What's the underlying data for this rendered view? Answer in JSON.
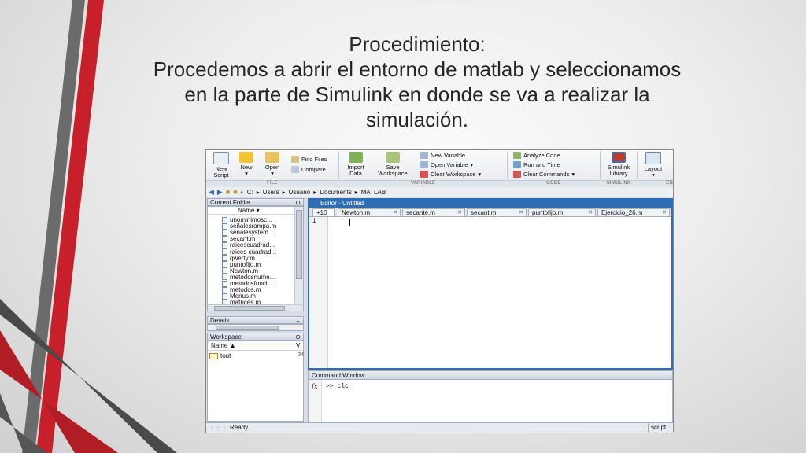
{
  "slide": {
    "title_lines": [
      "Procedimiento:",
      "Procedemos a abrir el entorno de matlab y seleccionamos",
      "en la parte de Simulink en donde se va a realizar la",
      "simulación."
    ]
  },
  "ribbon": {
    "new_script": [
      "New",
      "Script"
    ],
    "new": "New",
    "open": "Open",
    "find_files": "Find Files",
    "compare": "Compare",
    "import_data": [
      "Import",
      "Data"
    ],
    "save_workspace": [
      "Save",
      "Workspace"
    ],
    "new_variable": "New Variable",
    "open_variable": "Open Variable",
    "clear_workspace": "Clear Workspace",
    "analyze_code": "Analyze Code",
    "run_and_time": "Run and Time",
    "clear_commands": "Clear Commands",
    "simulink_library": [
      "Simulink",
      "Library"
    ],
    "layout": "Layout",
    "sections": {
      "file": "FILE",
      "variable": "VARIABLE",
      "code": "CODE",
      "simulink": "SIMULINK",
      "env": "EN"
    }
  },
  "address": {
    "crumbs": [
      "C:",
      "Users",
      "Usuario",
      "Documents",
      "MATLAB"
    ]
  },
  "current_folder": {
    "title": "Current Folder",
    "column": "Name ▾",
    "files": [
      "unominimosc...",
      "señalesrampa.m",
      "senalesystem...",
      "secant.m",
      "raicescuadrad...",
      "raices cuadrad...",
      "qwerty.m",
      "puntofijo.m",
      "Newton.m",
      "metodosnume...",
      "metodosfunci...",
      "metodos.m",
      "Menus.m",
      "matrices.m"
    ]
  },
  "details": {
    "title": "Details"
  },
  "workspace": {
    "title": "Workspace",
    "column": "Name ▲",
    "column2": "V",
    "vars": [
      {
        "name": "tout",
        "value": "34"
      }
    ]
  },
  "editor": {
    "title": "Editor - Untitled",
    "plus_tab": "+10",
    "tabs": [
      "Newton.m",
      "secante.m",
      "secant.m",
      "puntofijo.m",
      "Ejercicio_26.m"
    ],
    "line_numbers": [
      "1"
    ]
  },
  "command_window": {
    "title": "Command Window",
    "fx": "fx",
    "line": ">> clc"
  },
  "status": {
    "text": "Ready",
    "mode": "script"
  }
}
